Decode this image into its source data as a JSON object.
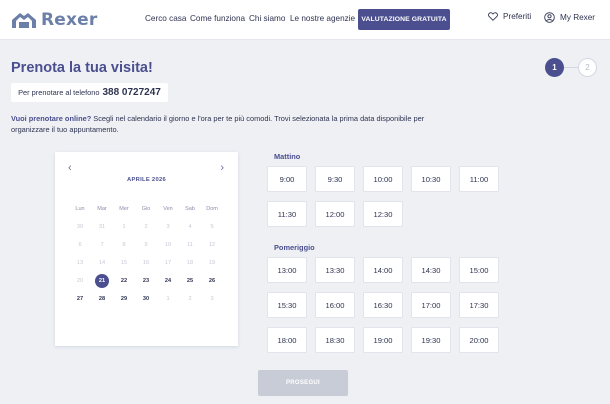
{
  "header": {
    "logo_text": "Rexer",
    "nav": [
      "Cerco casa",
      "Come funziona",
      "Chi siamo",
      "Le nostre agenzie"
    ],
    "cta_label": "VALUTAZIONE GRATUITA",
    "favorites_label": "Preferiti",
    "account_label": "My Rexer"
  },
  "page": {
    "title": "Prenota la tua visita!",
    "phone_prefix": "Per prenotare al telefono",
    "phone_number": "388 0727247",
    "intro_strong": "Vuoi prenotare online?",
    "intro_text": " Scegli nel calendario il giorno e l'ora per te più comodi. Trovi selezionata la prima data disponibile per organizzare il tuo appuntamento."
  },
  "steps": [
    "1",
    "2"
  ],
  "calendar": {
    "month_label": "APRILE 2026",
    "weekdays": [
      "Lun",
      "Mar",
      "Mer",
      "Gio",
      "Ven",
      "Sab",
      "Dom"
    ],
    "weeks": [
      [
        {
          "d": "30",
          "s": "off"
        },
        {
          "d": "31",
          "s": "off"
        },
        {
          "d": "1",
          "s": "off"
        },
        {
          "d": "2",
          "s": "off"
        },
        {
          "d": "3",
          "s": "off"
        },
        {
          "d": "4",
          "s": "off"
        },
        {
          "d": "5",
          "s": "off"
        }
      ],
      [
        {
          "d": "6",
          "s": "off"
        },
        {
          "d": "7",
          "s": "off"
        },
        {
          "d": "8",
          "s": "off"
        },
        {
          "d": "9",
          "s": "off"
        },
        {
          "d": "10",
          "s": "off"
        },
        {
          "d": "11",
          "s": "off"
        },
        {
          "d": "12",
          "s": "off"
        }
      ],
      [
        {
          "d": "13",
          "s": "off"
        },
        {
          "d": "14",
          "s": "off"
        },
        {
          "d": "15",
          "s": "off"
        },
        {
          "d": "16",
          "s": "off"
        },
        {
          "d": "17",
          "s": "off"
        },
        {
          "d": "18",
          "s": "off"
        },
        {
          "d": "19",
          "s": "off"
        }
      ],
      [
        {
          "d": "20",
          "s": "off"
        },
        {
          "d": "21",
          "s": "sel"
        },
        {
          "d": "22",
          "s": "av"
        },
        {
          "d": "23",
          "s": "av"
        },
        {
          "d": "24",
          "s": "av"
        },
        {
          "d": "25",
          "s": "av"
        },
        {
          "d": "26",
          "s": "av"
        }
      ],
      [
        {
          "d": "27",
          "s": "av"
        },
        {
          "d": "28",
          "s": "av"
        },
        {
          "d": "29",
          "s": "av"
        },
        {
          "d": "30",
          "s": "av"
        },
        {
          "d": "1",
          "s": "off"
        },
        {
          "d": "2",
          "s": "off"
        },
        {
          "d": "3",
          "s": "off"
        }
      ]
    ]
  },
  "morning": {
    "label": "Mattino",
    "slots": [
      "9:00",
      "9:30",
      "10:00",
      "10:30",
      "11:00",
      "11:30",
      "12:00",
      "12:30"
    ]
  },
  "afternoon": {
    "label": "Pomeriggio",
    "slots": [
      "13:00",
      "13:30",
      "14:00",
      "14:30",
      "15:00",
      "15:30",
      "16:00",
      "16:30",
      "17:00",
      "17:30",
      "18:00",
      "18:30",
      "19:00",
      "19:30",
      "20:00"
    ]
  },
  "submit_label": "PROSEGUI",
  "colors": {
    "accent": "#4b4f8f",
    "logo": "#6b7fa9",
    "background": "#eef0f4",
    "disabled": "#c8ccd6"
  }
}
